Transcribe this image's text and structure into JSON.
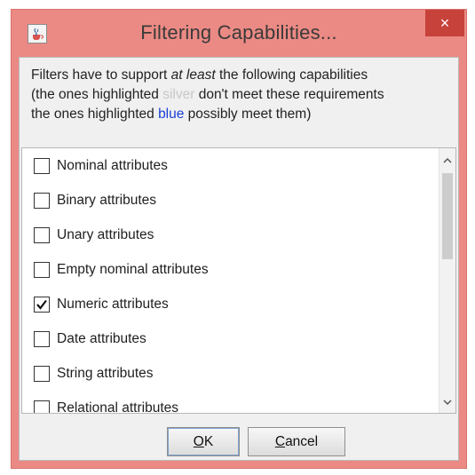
{
  "window": {
    "title": "Filtering Capabilities...",
    "close_glyph": "×"
  },
  "description": {
    "line1_pre": "Filters have to support ",
    "line1_emph": "at least",
    "line1_post": " the following capabilities",
    "line2_pre": "(the ones highlighted ",
    "line2_silver": "silver",
    "line2_post": " don't meet these requirements",
    "line3_pre": "the ones highlighted ",
    "line3_blue": "blue",
    "line3_post": " possibly meet them)"
  },
  "capabilities": [
    {
      "label": "Nominal attributes",
      "checked": false
    },
    {
      "label": "Binary attributes",
      "checked": false
    },
    {
      "label": "Unary attributes",
      "checked": false
    },
    {
      "label": "Empty nominal attributes",
      "checked": false
    },
    {
      "label": "Numeric attributes",
      "checked": true
    },
    {
      "label": "Date attributes",
      "checked": false
    },
    {
      "label": "String attributes",
      "checked": false
    },
    {
      "label": "Relational attributes",
      "checked": false
    }
  ],
  "buttons": {
    "ok_mnemonic": "O",
    "ok_rest": "K",
    "cancel_mnemonic": "C",
    "cancel_rest": "ancel"
  },
  "colors": {
    "title_bar": "#eb8a84",
    "close_button": "#c7423a",
    "blue_text": "#1a3fd6",
    "silver_text": "#c8c8c8"
  },
  "icons": {
    "app": "java-cup-icon",
    "close": "close-icon",
    "scroll_up": "chevron-up-icon",
    "scroll_down": "chevron-down-icon",
    "check": "checkmark-icon"
  }
}
